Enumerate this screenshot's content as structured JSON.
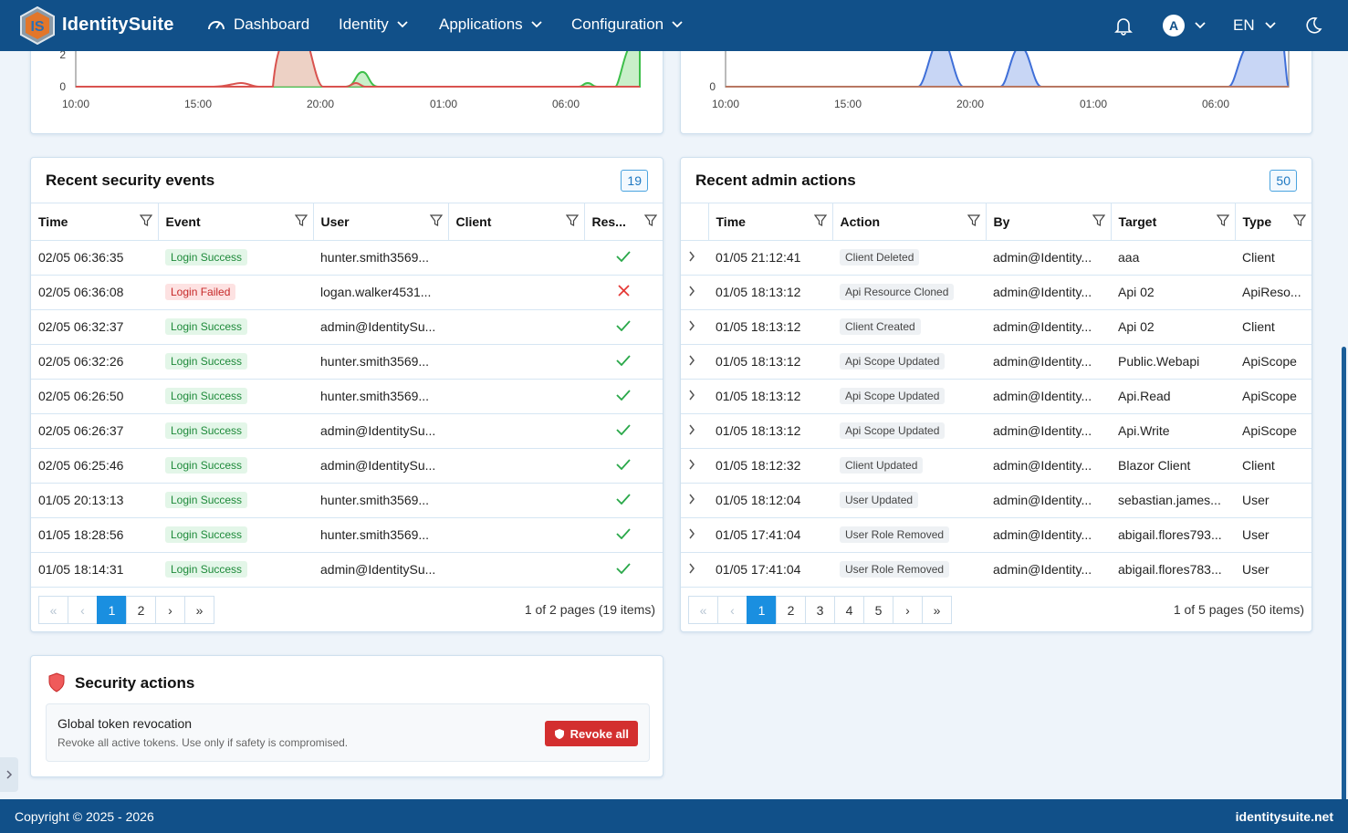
{
  "brand": {
    "name": "IdentitySuite",
    "logo_text": "IS"
  },
  "nav": {
    "dashboard": "Dashboard",
    "identity": "Identity",
    "applications": "Applications",
    "configuration": "Configuration",
    "avatar_initial": "A",
    "language": "EN"
  },
  "chart_left": {
    "y_ticks": [
      "2",
      "0"
    ],
    "x_ticks": [
      "10:00",
      "15:00",
      "20:00",
      "01:00",
      "06:00"
    ]
  },
  "chart_right": {
    "y_ticks": [
      "0"
    ],
    "x_ticks": [
      "10:00",
      "15:00",
      "20:00",
      "01:00",
      "06:00"
    ]
  },
  "security_events": {
    "title": "Recent security events",
    "count": "19",
    "columns": [
      "Time",
      "Event",
      "User",
      "Client",
      "Res..."
    ],
    "rows": [
      {
        "time": "02/05 06:36:35",
        "event": "Login Success",
        "user": "hunter.smith3569...",
        "client": "",
        "ok": true
      },
      {
        "time": "02/05 06:36:08",
        "event": "Login Failed",
        "user": "logan.walker4531...",
        "client": "",
        "ok": false
      },
      {
        "time": "02/05 06:32:37",
        "event": "Login Success",
        "user": "admin@IdentitySu...",
        "client": "",
        "ok": true
      },
      {
        "time": "02/05 06:32:26",
        "event": "Login Success",
        "user": "hunter.smith3569...",
        "client": "",
        "ok": true
      },
      {
        "time": "02/05 06:26:50",
        "event": "Login Success",
        "user": "hunter.smith3569...",
        "client": "",
        "ok": true
      },
      {
        "time": "02/05 06:26:37",
        "event": "Login Success",
        "user": "admin@IdentitySu...",
        "client": "",
        "ok": true
      },
      {
        "time": "02/05 06:25:46",
        "event": "Login Success",
        "user": "admin@IdentitySu...",
        "client": "",
        "ok": true
      },
      {
        "time": "01/05 20:13:13",
        "event": "Login Success",
        "user": "hunter.smith3569...",
        "client": "",
        "ok": true
      },
      {
        "time": "01/05 18:28:56",
        "event": "Login Success",
        "user": "hunter.smith3569...",
        "client": "",
        "ok": true
      },
      {
        "time": "01/05 18:14:31",
        "event": "Login Success",
        "user": "admin@IdentitySu...",
        "client": "",
        "ok": true
      }
    ],
    "pages": [
      "1",
      "2"
    ],
    "current_page": "1",
    "pager_info": "1 of 2 pages (19 items)"
  },
  "admin_actions": {
    "title": "Recent admin actions",
    "count": "50",
    "columns": [
      "Time",
      "Action",
      "By",
      "Target",
      "Type"
    ],
    "rows": [
      {
        "time": "01/05 21:12:41",
        "action": "Client Deleted",
        "by": "admin@Identity...",
        "target": "aaa",
        "type": "Client"
      },
      {
        "time": "01/05 18:13:12",
        "action": "Api Resource Cloned",
        "by": "admin@Identity...",
        "target": "Api 02",
        "type": "ApiReso..."
      },
      {
        "time": "01/05 18:13:12",
        "action": "Client Created",
        "by": "admin@Identity...",
        "target": "Api 02",
        "type": "Client"
      },
      {
        "time": "01/05 18:13:12",
        "action": "Api Scope Updated",
        "by": "admin@Identity...",
        "target": "Public.Webapi",
        "type": "ApiScope"
      },
      {
        "time": "01/05 18:13:12",
        "action": "Api Scope Updated",
        "by": "admin@Identity...",
        "target": "Api.Read",
        "type": "ApiScope"
      },
      {
        "time": "01/05 18:13:12",
        "action": "Api Scope Updated",
        "by": "admin@Identity...",
        "target": "Api.Write",
        "type": "ApiScope"
      },
      {
        "time": "01/05 18:12:32",
        "action": "Client Updated",
        "by": "admin@Identity...",
        "target": "Blazor Client",
        "type": "Client"
      },
      {
        "time": "01/05 18:12:04",
        "action": "User Updated",
        "by": "admin@Identity...",
        "target": "sebastian.james...",
        "type": "User"
      },
      {
        "time": "01/05 17:41:04",
        "action": "User Role Removed",
        "by": "admin@Identity...",
        "target": "abigail.flores793...",
        "type": "User"
      },
      {
        "time": "01/05 17:41:04",
        "action": "User Role Removed",
        "by": "admin@Identity...",
        "target": "abigail.flores783...",
        "type": "User"
      }
    ],
    "pages": [
      "1",
      "2",
      "3",
      "4",
      "5"
    ],
    "current_page": "1",
    "pager_info": "1 of 5 pages (50 items)"
  },
  "security_actions": {
    "title": "Security actions",
    "item_title": "Global token revocation",
    "item_desc": "Revoke all active tokens. Use only if safety is compromised.",
    "button": "Revoke all"
  },
  "footer": {
    "copyright": "Copyright © 2025 - 2026",
    "site": "identitysuite.net"
  },
  "colors": {
    "nav": "#115089",
    "accent": "#1a8fe0",
    "danger": "#d32f2f",
    "success": "#2aa84a"
  }
}
